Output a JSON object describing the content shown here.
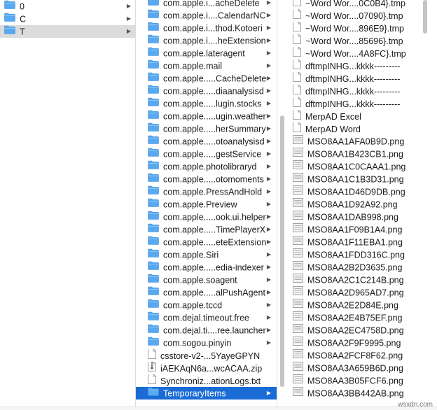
{
  "colors": {
    "folder": "#5aa9f0",
    "selection_active": "#1a6bd6",
    "selection_inactive": "#dcdcdc"
  },
  "col1": {
    "items": [
      {
        "label": "0",
        "icon": "folder-icon",
        "chevron": true,
        "selected": false
      },
      {
        "label": "C",
        "icon": "folder-icon",
        "chevron": true,
        "selected": false
      },
      {
        "label": "T",
        "icon": "folder-icon",
        "chevron": true,
        "selected": true
      }
    ]
  },
  "col2": {
    "items": [
      {
        "label": "com.apple.i...acheDelete",
        "icon": "folder-icon",
        "chevron": true
      },
      {
        "label": "com.apple.i....CalendarNC",
        "icon": "folder-icon",
        "chevron": true
      },
      {
        "label": "com.apple.i...thod.Kotoeri",
        "icon": "folder-icon",
        "chevron": true
      },
      {
        "label": "com.apple.i....heExtension",
        "icon": "folder-icon",
        "chevron": true
      },
      {
        "label": "com.apple.lateragent",
        "icon": "folder-icon",
        "chevron": true
      },
      {
        "label": "com.apple.mail",
        "icon": "folder-icon",
        "chevron": true
      },
      {
        "label": "com.apple.....CacheDelete",
        "icon": "folder-icon",
        "chevron": true
      },
      {
        "label": "com.apple.....diaanalysisd",
        "icon": "folder-icon",
        "chevron": true
      },
      {
        "label": "com.apple.....lugin.stocks",
        "icon": "folder-icon",
        "chevron": true
      },
      {
        "label": "com.apple.....ugin.weather",
        "icon": "folder-icon",
        "chevron": true
      },
      {
        "label": "com.apple.....herSummary",
        "icon": "folder-icon",
        "chevron": true
      },
      {
        "label": "com.apple.....otoanalysisd",
        "icon": "folder-icon",
        "chevron": true
      },
      {
        "label": "com.apple.....gestService",
        "icon": "folder-icon",
        "chevron": true
      },
      {
        "label": "com.apple.photolibraryd",
        "icon": "folder-icon",
        "chevron": true
      },
      {
        "label": "com.apple.....otomoments",
        "icon": "folder-icon",
        "chevron": true
      },
      {
        "label": "com.apple.PressAndHold",
        "icon": "folder-icon",
        "chevron": true
      },
      {
        "label": "com.apple.Preview",
        "icon": "folder-icon",
        "chevron": true
      },
      {
        "label": "com.apple.....ook.ui.helper",
        "icon": "folder-icon",
        "chevron": true
      },
      {
        "label": "com.apple.....TimePlayerX",
        "icon": "folder-icon",
        "chevron": true
      },
      {
        "label": "com.apple.....eteExtension",
        "icon": "folder-icon",
        "chevron": true
      },
      {
        "label": "com.apple.Siri",
        "icon": "folder-icon",
        "chevron": true
      },
      {
        "label": "com.apple.....edia-indexer",
        "icon": "folder-icon",
        "chevron": true
      },
      {
        "label": "com.apple.soagent",
        "icon": "folder-icon",
        "chevron": true
      },
      {
        "label": "com.apple.....alPushAgent",
        "icon": "folder-icon",
        "chevron": true
      },
      {
        "label": "com.apple.tccd",
        "icon": "folder-icon",
        "chevron": true
      },
      {
        "label": "com.dejal.timeout.free",
        "icon": "folder-icon",
        "chevron": true
      },
      {
        "label": "com.dejal.ti....ree.launcher",
        "icon": "folder-icon",
        "chevron": true
      },
      {
        "label": "com.sogou.pinyin",
        "icon": "folder-icon",
        "chevron": true
      },
      {
        "label": "csstore-v2-...5YayeGPYN",
        "icon": "document-icon",
        "chevron": false
      },
      {
        "label": "iAEKAqN6a...wcACAA.zip",
        "icon": "zip-file-icon",
        "chevron": false
      },
      {
        "label": "Synchroniz...ationLogs.txt",
        "icon": "document-icon",
        "chevron": false
      },
      {
        "label": "TemporaryItems",
        "icon": "folder-icon",
        "chevron": true,
        "selected": true
      }
    ]
  },
  "col3": {
    "items": [
      {
        "label": "~Word Wor....0C0B4}.tmp",
        "icon": "document-icon"
      },
      {
        "label": "~Word Wor....07090}.tmp",
        "icon": "document-icon"
      },
      {
        "label": "~Word Wor....896E9}.tmp",
        "icon": "document-icon"
      },
      {
        "label": "~Word Wor....85696}.tmp",
        "icon": "document-icon"
      },
      {
        "label": "~Word Wor....4A8FC}.tmp",
        "icon": "document-icon"
      },
      {
        "label": "dftmpINHG...kkkk---------",
        "icon": "document-icon"
      },
      {
        "label": "dftmpINHG...kkkk---------",
        "icon": "document-icon"
      },
      {
        "label": "dftmpINHG...kkkk---------",
        "icon": "document-icon"
      },
      {
        "label": "dftmpINHG...kkkk---------",
        "icon": "document-icon"
      },
      {
        "label": "MerpAD Excel",
        "icon": "document-icon"
      },
      {
        "label": "MerpAD Word",
        "icon": "document-icon"
      },
      {
        "label": "MSO8AA1AFA0B9D.png",
        "icon": "image-file-icon"
      },
      {
        "label": "MSO8AA1B423CB1.png",
        "icon": "image-file-icon"
      },
      {
        "label": "MSO8AA1C0CAAA1.png",
        "icon": "image-file-icon"
      },
      {
        "label": "MSO8AA1C1B3D31.png",
        "icon": "image-file-icon"
      },
      {
        "label": "MSO8AA1D46D9DB.png",
        "icon": "image-file-icon"
      },
      {
        "label": "MSO8AA1D92A92.png",
        "icon": "image-file-icon"
      },
      {
        "label": "MSO8AA1DAB998.png",
        "icon": "image-file-icon"
      },
      {
        "label": "MSO8AA1F09B1A4.png",
        "icon": "image-file-icon"
      },
      {
        "label": "MSO8AA1F11EBA1.png",
        "icon": "image-file-icon"
      },
      {
        "label": "MSO8AA1FDD316C.png",
        "icon": "image-file-icon"
      },
      {
        "label": "MSO8AA2B2D3635.png",
        "icon": "image-file-icon"
      },
      {
        "label": "MSO8AA2C1C214B.png",
        "icon": "image-file-icon"
      },
      {
        "label": "MSO8AA2D965AD7.png",
        "icon": "image-file-icon"
      },
      {
        "label": "MSO8AA2E2D84E.png",
        "icon": "image-file-icon"
      },
      {
        "label": "MSO8AA2E4B75EF.png",
        "icon": "image-file-icon"
      },
      {
        "label": "MSO8AA2EC4758D.png",
        "icon": "image-file-icon"
      },
      {
        "label": "MSO8AA2F9F9995.png",
        "icon": "image-file-icon"
      },
      {
        "label": "MSO8AA2FCF8F62.png",
        "icon": "image-file-icon"
      },
      {
        "label": "MSO8AA3A659B6D.png",
        "icon": "image-file-icon"
      },
      {
        "label": "MSO8AA3B05FCF6.png",
        "icon": "image-file-icon"
      },
      {
        "label": "MSO8AA3BB442AB.png",
        "icon": "image-file-icon"
      }
    ]
  },
  "watermark": "wsxdn.com"
}
